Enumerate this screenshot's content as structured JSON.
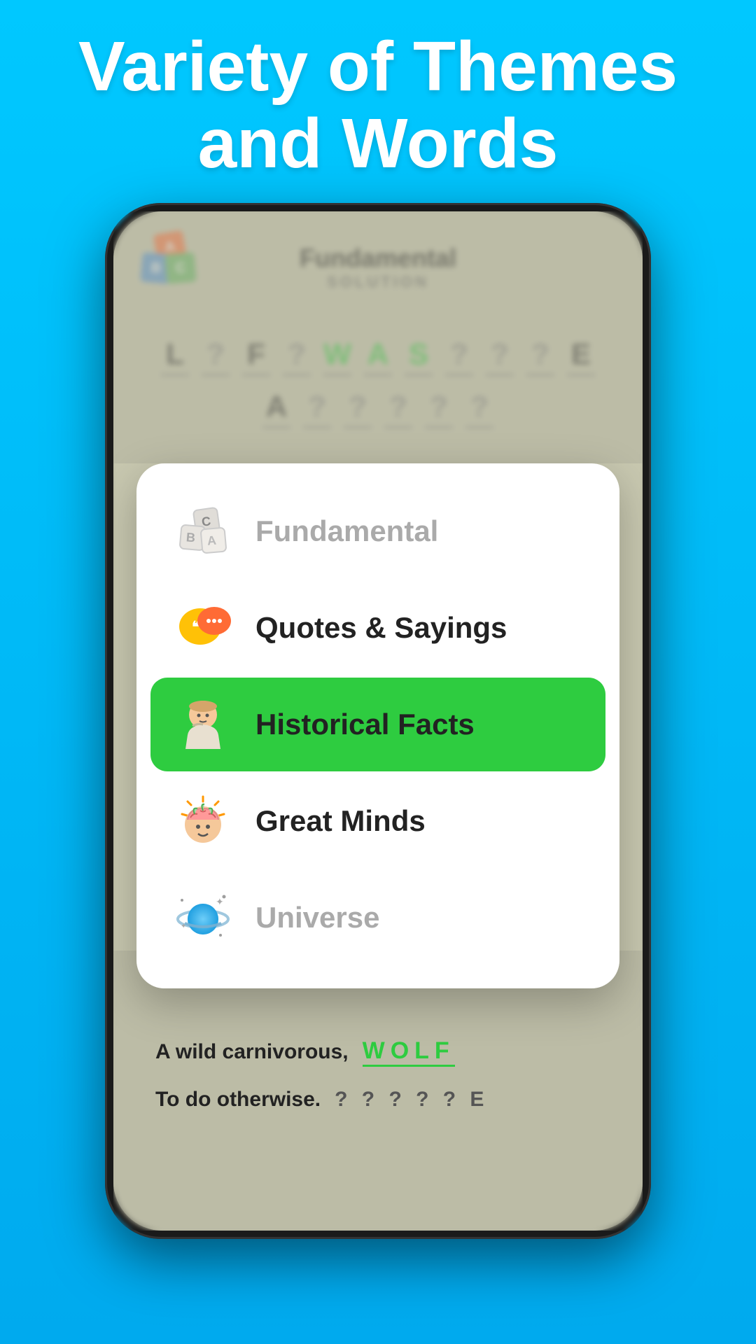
{
  "header": {
    "title": "Variety of Themes and Words"
  },
  "app": {
    "logo_blocks": [
      {
        "letter": "A",
        "color": "#ff6b35"
      },
      {
        "letter": "B",
        "color": "#4a90d9"
      },
      {
        "letter": "C",
        "color": "#5cb85c"
      }
    ],
    "game_title": "Fundamental",
    "game_subtitle": "SOLUTION",
    "word_row1": [
      "L",
      "?",
      "F",
      "?",
      "W",
      "A",
      "S",
      "?",
      "?",
      "?",
      "E"
    ],
    "word_row2": [
      "A",
      "?",
      "?",
      "?",
      "?",
      "?"
    ]
  },
  "menu": {
    "items": [
      {
        "id": "fundamental",
        "label": "Fundamental",
        "active": false,
        "muted": true
      },
      {
        "id": "quotes",
        "label": "Quotes & Sayings",
        "active": false,
        "muted": false
      },
      {
        "id": "historical",
        "label": "Historical Facts",
        "active": true,
        "muted": false
      },
      {
        "id": "great-minds",
        "label": "Great Minds",
        "active": false,
        "muted": false
      },
      {
        "id": "universe",
        "label": "Universe",
        "active": false,
        "muted": false
      }
    ]
  },
  "bottom_clues": [
    {
      "clue": "A wild carnivorous,",
      "answer": "WOLF"
    },
    {
      "clue": "To do otherwise.",
      "answer": "? ? ? ? ? E"
    }
  ],
  "colors": {
    "background": "#00c8ff",
    "active_green": "#2ecc40",
    "text_white": "#ffffff",
    "text_dark": "#222222",
    "text_muted": "#aaaaaa"
  }
}
